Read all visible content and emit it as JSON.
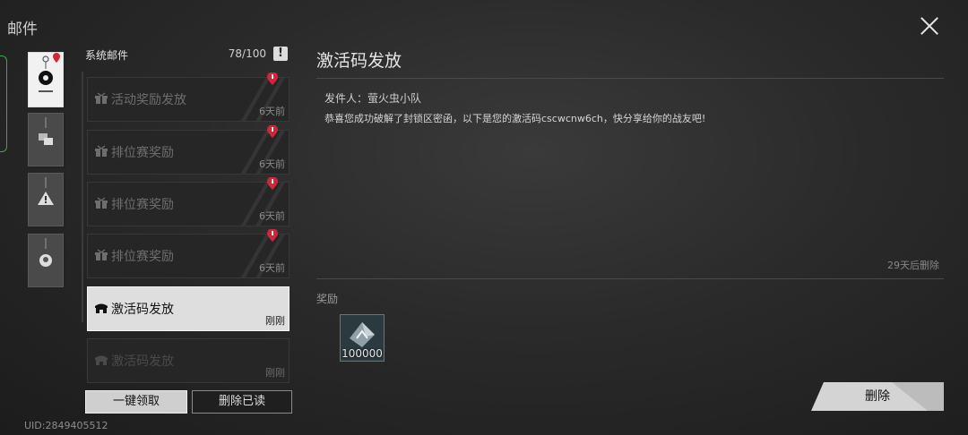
{
  "page": {
    "title": "邮件"
  },
  "mail_list": {
    "header_label": "系统邮件",
    "count": "78/100",
    "warning_icon": "exclamation-icon",
    "items": [
      {
        "title": "活动奖励发放",
        "time": "6天前",
        "unread": true,
        "icon": "gift-icon"
      },
      {
        "title": "排位赛奖励",
        "time": "6天前",
        "unread": true,
        "icon": "gift-icon"
      },
      {
        "title": "排位赛奖励",
        "time": "6天前",
        "unread": true,
        "icon": "gift-icon"
      },
      {
        "title": "排位赛奖励",
        "time": "6天前",
        "unread": true,
        "icon": "gift-icon"
      },
      {
        "title": "激活码发放",
        "time": "刚刚",
        "unread": false,
        "selected": true,
        "icon": "mailbox-icon"
      },
      {
        "title": "激活码发放",
        "time": "刚刚",
        "unread": false,
        "icon": "mailbox-icon"
      }
    ]
  },
  "buttons": {
    "claim_all": "一键领取",
    "delete_read": "删除已读",
    "delete": "删除"
  },
  "uid": "UID:2849405512",
  "detail": {
    "title": "激活码发放",
    "sender": "发件人：萤火虫小队",
    "body": "恭喜您成功破解了封锁区密函，以下是您的激活码cscwcnw6ch，快分享给你的战友吧!",
    "expiry": "29天后删除",
    "rewards_label": "奖励",
    "rewards": [
      {
        "icon": "crystal-icon",
        "quantity": "100000"
      }
    ]
  },
  "colors": {
    "accent_green": "#3ea84a",
    "unread_red": "#d0263a",
    "selected_bg": "#dedede"
  }
}
